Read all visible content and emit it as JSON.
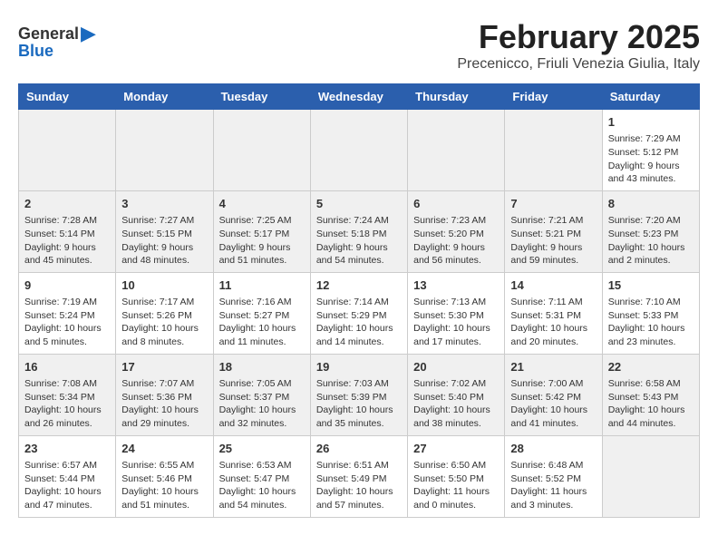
{
  "logo": {
    "general": "General",
    "blue": "Blue"
  },
  "header": {
    "title": "February 2025",
    "subtitle": "Precenicco, Friuli Venezia Giulia, Italy"
  },
  "days_of_week": [
    "Sunday",
    "Monday",
    "Tuesday",
    "Wednesday",
    "Thursday",
    "Friday",
    "Saturday"
  ],
  "weeks": [
    {
      "shaded": false,
      "days": [
        {
          "num": "",
          "text": ""
        },
        {
          "num": "",
          "text": ""
        },
        {
          "num": "",
          "text": ""
        },
        {
          "num": "",
          "text": ""
        },
        {
          "num": "",
          "text": ""
        },
        {
          "num": "",
          "text": ""
        },
        {
          "num": "1",
          "text": "Sunrise: 7:29 AM\nSunset: 5:12 PM\nDaylight: 9 hours and 43 minutes."
        }
      ]
    },
    {
      "shaded": true,
      "days": [
        {
          "num": "2",
          "text": "Sunrise: 7:28 AM\nSunset: 5:14 PM\nDaylight: 9 hours and 45 minutes."
        },
        {
          "num": "3",
          "text": "Sunrise: 7:27 AM\nSunset: 5:15 PM\nDaylight: 9 hours and 48 minutes."
        },
        {
          "num": "4",
          "text": "Sunrise: 7:25 AM\nSunset: 5:17 PM\nDaylight: 9 hours and 51 minutes."
        },
        {
          "num": "5",
          "text": "Sunrise: 7:24 AM\nSunset: 5:18 PM\nDaylight: 9 hours and 54 minutes."
        },
        {
          "num": "6",
          "text": "Sunrise: 7:23 AM\nSunset: 5:20 PM\nDaylight: 9 hours and 56 minutes."
        },
        {
          "num": "7",
          "text": "Sunrise: 7:21 AM\nSunset: 5:21 PM\nDaylight: 9 hours and 59 minutes."
        },
        {
          "num": "8",
          "text": "Sunrise: 7:20 AM\nSunset: 5:23 PM\nDaylight: 10 hours and 2 minutes."
        }
      ]
    },
    {
      "shaded": false,
      "days": [
        {
          "num": "9",
          "text": "Sunrise: 7:19 AM\nSunset: 5:24 PM\nDaylight: 10 hours and 5 minutes."
        },
        {
          "num": "10",
          "text": "Sunrise: 7:17 AM\nSunset: 5:26 PM\nDaylight: 10 hours and 8 minutes."
        },
        {
          "num": "11",
          "text": "Sunrise: 7:16 AM\nSunset: 5:27 PM\nDaylight: 10 hours and 11 minutes."
        },
        {
          "num": "12",
          "text": "Sunrise: 7:14 AM\nSunset: 5:29 PM\nDaylight: 10 hours and 14 minutes."
        },
        {
          "num": "13",
          "text": "Sunrise: 7:13 AM\nSunset: 5:30 PM\nDaylight: 10 hours and 17 minutes."
        },
        {
          "num": "14",
          "text": "Sunrise: 7:11 AM\nSunset: 5:31 PM\nDaylight: 10 hours and 20 minutes."
        },
        {
          "num": "15",
          "text": "Sunrise: 7:10 AM\nSunset: 5:33 PM\nDaylight: 10 hours and 23 minutes."
        }
      ]
    },
    {
      "shaded": true,
      "days": [
        {
          "num": "16",
          "text": "Sunrise: 7:08 AM\nSunset: 5:34 PM\nDaylight: 10 hours and 26 minutes."
        },
        {
          "num": "17",
          "text": "Sunrise: 7:07 AM\nSunset: 5:36 PM\nDaylight: 10 hours and 29 minutes."
        },
        {
          "num": "18",
          "text": "Sunrise: 7:05 AM\nSunset: 5:37 PM\nDaylight: 10 hours and 32 minutes."
        },
        {
          "num": "19",
          "text": "Sunrise: 7:03 AM\nSunset: 5:39 PM\nDaylight: 10 hours and 35 minutes."
        },
        {
          "num": "20",
          "text": "Sunrise: 7:02 AM\nSunset: 5:40 PM\nDaylight: 10 hours and 38 minutes."
        },
        {
          "num": "21",
          "text": "Sunrise: 7:00 AM\nSunset: 5:42 PM\nDaylight: 10 hours and 41 minutes."
        },
        {
          "num": "22",
          "text": "Sunrise: 6:58 AM\nSunset: 5:43 PM\nDaylight: 10 hours and 44 minutes."
        }
      ]
    },
    {
      "shaded": false,
      "days": [
        {
          "num": "23",
          "text": "Sunrise: 6:57 AM\nSunset: 5:44 PM\nDaylight: 10 hours and 47 minutes."
        },
        {
          "num": "24",
          "text": "Sunrise: 6:55 AM\nSunset: 5:46 PM\nDaylight: 10 hours and 51 minutes."
        },
        {
          "num": "25",
          "text": "Sunrise: 6:53 AM\nSunset: 5:47 PM\nDaylight: 10 hours and 54 minutes."
        },
        {
          "num": "26",
          "text": "Sunrise: 6:51 AM\nSunset: 5:49 PM\nDaylight: 10 hours and 57 minutes."
        },
        {
          "num": "27",
          "text": "Sunrise: 6:50 AM\nSunset: 5:50 PM\nDaylight: 11 hours and 0 minutes."
        },
        {
          "num": "28",
          "text": "Sunrise: 6:48 AM\nSunset: 5:52 PM\nDaylight: 11 hours and 3 minutes."
        },
        {
          "num": "",
          "text": ""
        }
      ]
    }
  ]
}
